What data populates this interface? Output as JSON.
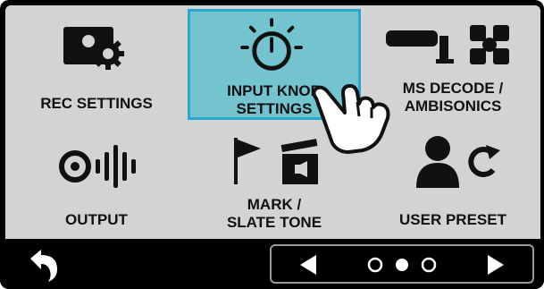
{
  "menu": {
    "tiles": [
      {
        "name": "rec-settings",
        "lines": [
          "REC SETTINGS"
        ]
      },
      {
        "name": "input-knob-settings",
        "lines": [
          "INPUT KNOB",
          "SETTINGS"
        ]
      },
      {
        "name": "ms-decode-ambisonics",
        "lines": [
          "MS DECODE /",
          "AMBISONICS"
        ]
      },
      {
        "name": "output",
        "lines": [
          "OUTPUT"
        ]
      },
      {
        "name": "mark-slate-tone",
        "lines": [
          "MARK /",
          "SLATE TONE"
        ]
      },
      {
        "name": "user-preset",
        "lines": [
          "USER PRESET"
        ]
      }
    ],
    "selected_tile": "input-knob-settings"
  },
  "pager": {
    "page_count": 3,
    "current_page": 2
  },
  "icons": {
    "rec_settings": "camera-gear-icon",
    "input_knob_settings": "knob-icon",
    "ms_decode": "mic-ambisonics-icon",
    "output": "output-speaker-icon",
    "mark_slate": "flag-clapperboard-icon",
    "user_preset": "user-refresh-icon",
    "back": "back-arrow-icon",
    "prev": "left-arrow-icon",
    "next": "right-arrow-icon"
  },
  "colors": {
    "screen_bg": "#d3d3d3",
    "selected_bg": "#74c4cf",
    "selected_border": "#2aa7d0",
    "bar_bg": "#000000"
  }
}
